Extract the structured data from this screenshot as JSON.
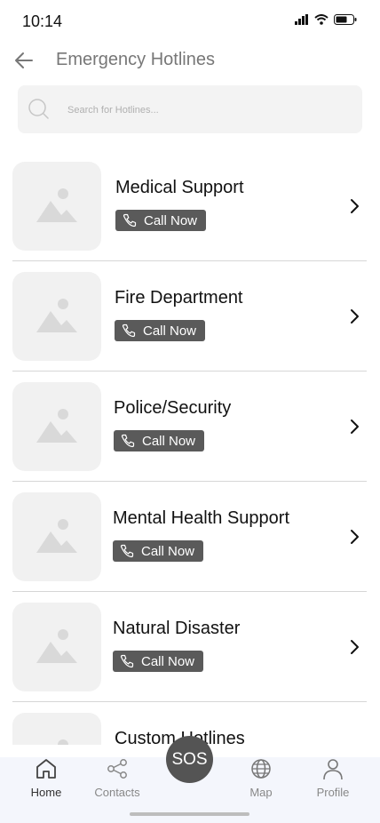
{
  "status_bar": {
    "time": "10:14"
  },
  "header": {
    "title": "Emergency Hotlines"
  },
  "search": {
    "placeholder": "Search for Hotlines..."
  },
  "hotlines": [
    {
      "title": "Medical Support",
      "action": "Call Now"
    },
    {
      "title": "Fire Department",
      "action": "Call Now"
    },
    {
      "title": "Police/Security",
      "action": "Call Now"
    },
    {
      "title": "Mental Health Support",
      "action": "Call Now"
    },
    {
      "title": "Natural Disaster",
      "action": "Call Now"
    },
    {
      "title": "Custom Hotlines",
      "action": ""
    }
  ],
  "nav": {
    "home": "Home",
    "contacts": "Contacts",
    "sos": "SOS",
    "map": "Map",
    "profile": "Profile"
  },
  "colors": {
    "accent": "#545454",
    "badge": "#5a5a5a",
    "title": "#777777",
    "nav_bg": "#f4f6fc"
  }
}
